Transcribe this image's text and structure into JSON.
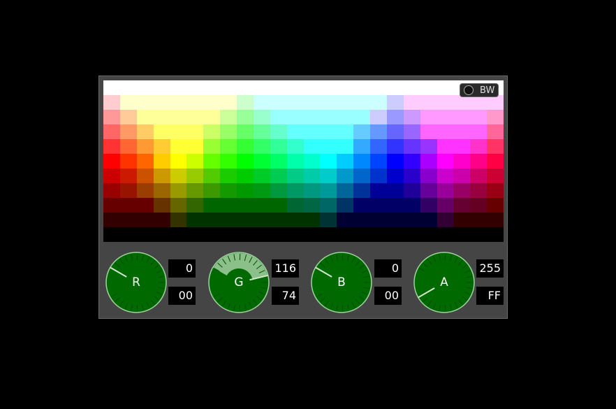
{
  "bw_toggle": {
    "label": "BW",
    "on": false
  },
  "palette": {
    "rows": [
      [
        "#ffffff",
        "#ffffff",
        "#ffffff",
        "#ffffff",
        "#ffffff",
        "#ffffff",
        "#ffffff",
        "#ffffff",
        "#ffffff",
        "#ffffff",
        "#ffffff",
        "#ffffff",
        "#ffffff",
        "#ffffff",
        "#ffffff",
        "#ffffff",
        "#ffffff",
        "#ffffff",
        "#ffffff",
        "#ffffff",
        "#ffffff",
        "#ffffff",
        "#ffffff",
        "#ffffff"
      ],
      [
        "#ffccd0",
        "#ffffcc",
        "#ffffcc",
        "#ffffcc",
        "#ffffcc",
        "#ffffcc",
        "#ffffcc",
        "#ffffcc",
        "#ccffcc",
        "#ccffff",
        "#ccffff",
        "#ccffff",
        "#ccffff",
        "#ccffff",
        "#ccffff",
        "#ccffff",
        "#ccffff",
        "#ccccff",
        "#ffccff",
        "#ffccff",
        "#ffccff",
        "#ffccff",
        "#ffccff",
        "#ffccff"
      ],
      [
        "#ff9999",
        "#ffcc99",
        "#ffff99",
        "#ffff99",
        "#ffff99",
        "#ffff99",
        "#ffff99",
        "#ccff99",
        "#99ff99",
        "#99ffcc",
        "#99ffff",
        "#99ffff",
        "#99ffff",
        "#99ffff",
        "#99ffff",
        "#99ffff",
        "#ccccff",
        "#9999ff",
        "#cc99ff",
        "#ff99ff",
        "#ff99ff",
        "#ff99ff",
        "#ff99ff",
        "#ff99cc"
      ],
      [
        "#ff6666",
        "#ff9966",
        "#ffcc66",
        "#ffff66",
        "#ffff66",
        "#ffff66",
        "#ccff66",
        "#99ff66",
        "#66ff66",
        "#66ff99",
        "#66ffcc",
        "#66ffff",
        "#66ffff",
        "#66ffff",
        "#66ffff",
        "#66ccff",
        "#6699ff",
        "#6666ff",
        "#9966ff",
        "#ff66ff",
        "#ff66ff",
        "#ff66ff",
        "#ff66ff",
        "#ff6699"
      ],
      [
        "#ff3333",
        "#ff6633",
        "#ff9933",
        "#ffcc33",
        "#ffff33",
        "#ffff33",
        "#99ff33",
        "#66ff33",
        "#33ff33",
        "#33ff66",
        "#33ff99",
        "#33ffcc",
        "#33ffff",
        "#33ffff",
        "#33ffff",
        "#33aaff",
        "#3366ff",
        "#3333ff",
        "#6633ff",
        "#9933ff",
        "#ff33ff",
        "#ff33ff",
        "#ff33cc",
        "#ff3366"
      ],
      [
        "#ff0000",
        "#ff3300",
        "#ff6600",
        "#ffcc00",
        "#ffff00",
        "#ccff00",
        "#66ff00",
        "#33ff00",
        "#00ff00",
        "#00ff33",
        "#00ff66",
        "#00ffaa",
        "#00ffcc",
        "#00ffff",
        "#00ccff",
        "#0088ff",
        "#0044ff",
        "#0000ff",
        "#3300ff",
        "#aa00ff",
        "#ff00ff",
        "#ff00cc",
        "#ff0088",
        "#ff0044"
      ],
      [
        "#cc0000",
        "#cc1a00",
        "#cc5200",
        "#cc9900",
        "#cccc00",
        "#99cc00",
        "#52cc00",
        "#1acc00",
        "#00cc00",
        "#00cc29",
        "#00cc52",
        "#00cc88",
        "#00ccaa",
        "#00cccc",
        "#0099cc",
        "#0066cc",
        "#0033cc",
        "#0000cc",
        "#2900cc",
        "#8800cc",
        "#cc00cc",
        "#cc00aa",
        "#cc0066",
        "#cc0033"
      ],
      [
        "#990000",
        "#991400",
        "#993d00",
        "#996600",
        "#999900",
        "#669900",
        "#3d9900",
        "#149900",
        "#009900",
        "#009914",
        "#00993d",
        "#009966",
        "#009980",
        "#009999",
        "#006699",
        "#003399",
        "#000099",
        "#000099",
        "#1f0099",
        "#660099",
        "#990099",
        "#990066",
        "#99003d",
        "#990014"
      ],
      [
        "#660000",
        "#660000",
        "#660000",
        "#663300",
        "#666600",
        "#336600",
        "#006600",
        "#006600",
        "#006600",
        "#006600",
        "#006600",
        "#006633",
        "#006644",
        "#006666",
        "#003366",
        "#000066",
        "#000066",
        "#000066",
        "#000066",
        "#330066",
        "#660066",
        "#660033",
        "#660022",
        "#660000"
      ],
      [
        "#330000",
        "#330000",
        "#330000",
        "#330000",
        "#333300",
        "#003300",
        "#003300",
        "#003300",
        "#003300",
        "#003300",
        "#003300",
        "#003300",
        "#003300",
        "#003333",
        "#000033",
        "#000033",
        "#000033",
        "#000033",
        "#000033",
        "#000033",
        "#330033",
        "#330000",
        "#330000",
        "#330000"
      ],
      [
        "#000000",
        "#000000",
        "#000000",
        "#000000",
        "#000000",
        "#000000",
        "#000000",
        "#000000",
        "#000000",
        "#000000",
        "#000000",
        "#000000",
        "#000000",
        "#000000",
        "#000000",
        "#000000",
        "#000000",
        "#000000",
        "#000000",
        "#000000",
        "#000000",
        "#000000",
        "#000000",
        "#000000"
      ]
    ]
  },
  "channels": [
    {
      "label": "R",
      "value": 0,
      "decimal": "0",
      "hex": "00"
    },
    {
      "label": "G",
      "value": 116,
      "decimal": "116",
      "hex": "74"
    },
    {
      "label": "B",
      "value": 0,
      "decimal": "0",
      "hex": "00"
    },
    {
      "label": "A",
      "value": 255,
      "decimal": "255",
      "hex": "FF"
    }
  ],
  "colors": {
    "panel": "#454545",
    "dial_fill": "#006a00",
    "dial_ring": "#9fd39f",
    "dial_tick": "#004a00",
    "dial_active": "#8bc08b"
  }
}
